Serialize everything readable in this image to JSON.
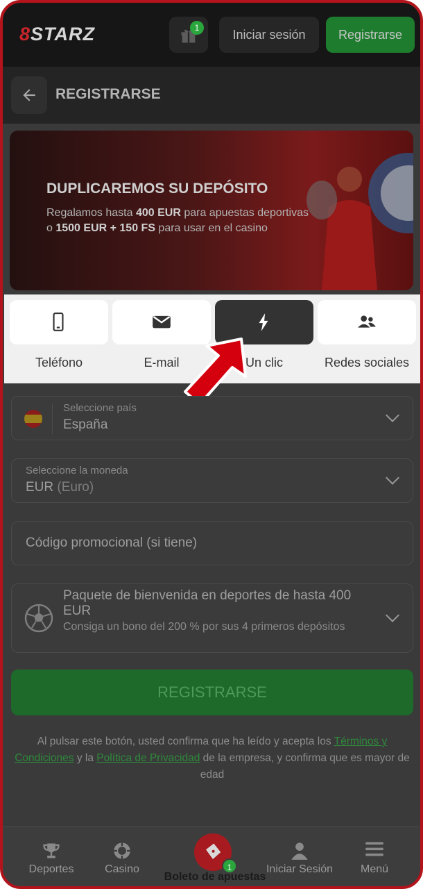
{
  "header": {
    "logo_text": "STARZ",
    "gift_badge": "1",
    "login_label": "Iniciar sesión",
    "register_label": "Registrarse"
  },
  "subheader": {
    "title": "REGISTRARSE"
  },
  "banner": {
    "title": "DUPLICAREMOS SU DEPÓSITO",
    "line1_pre": "Regalamos hasta ",
    "line1_bold": "400 EUR",
    "line1_post": " para apuestas deportivas",
    "line2_pre": "o ",
    "line2_bold": "1500 EUR + 150 FS",
    "line2_post": " para usar en el casino"
  },
  "tabs": [
    {
      "label": "Teléfono",
      "icon": "phone-icon",
      "active": false
    },
    {
      "label": "E-mail",
      "icon": "mail-icon",
      "active": false
    },
    {
      "label": "Un clic",
      "icon": "lightning-icon",
      "active": true
    },
    {
      "label": "Redes sociales",
      "icon": "users-icon",
      "active": false
    }
  ],
  "form": {
    "country_label": "Seleccione país",
    "country_value": "España",
    "currency_label": "Seleccione la moneda",
    "currency_code": "EUR",
    "currency_name": "(Euro)",
    "promo_placeholder": "Código promocional (si tiene)",
    "bonus_title": "Paquete de bienvenida en deportes de hasta 400 EUR",
    "bonus_desc": "Consiga un bono del 200 % por sus 4 primeros depósitos",
    "submit_label": "REGISTRARSE"
  },
  "legal": {
    "text1": "Al pulsar este botón, usted confirma que ha leído y acepta los ",
    "terms_link": "Términos y Condiciones",
    "text2": " y la ",
    "privacy_link": "Política de Privacidad",
    "text3": " de la empresa, y confirma que es mayor de edad"
  },
  "bottom_nav": {
    "sports": "Deportes",
    "casino": "Casino",
    "betslip": "Boleto de apuestas",
    "betslip_badge": "1",
    "login": "Iniciar Sesión",
    "menu": "Menú"
  },
  "colors": {
    "frame_border": "#b3141b",
    "accent_green": "#1e7c2e",
    "brand_red": "#c9252b",
    "pointer_red": "#d5000e"
  }
}
